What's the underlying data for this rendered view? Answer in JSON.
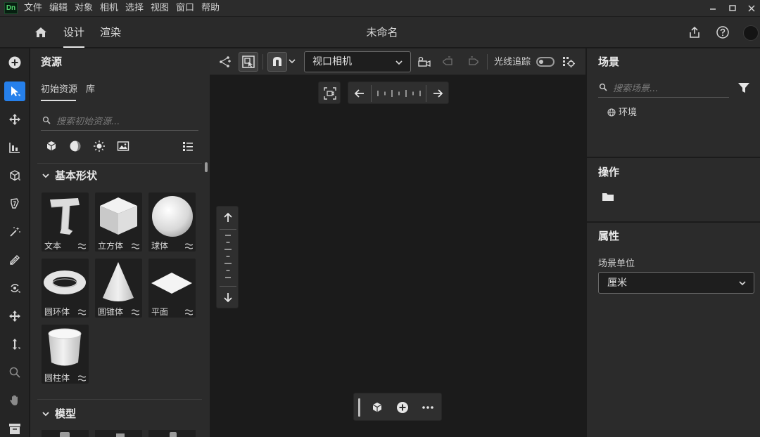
{
  "menubar": {
    "logo": "Dn",
    "items": [
      "文件",
      "编辑",
      "对象",
      "相机",
      "选择",
      "视图",
      "窗口",
      "帮助"
    ]
  },
  "header": {
    "tabs": [
      "设计",
      "渲染"
    ],
    "active_tab": "设计",
    "document_title": "未命名"
  },
  "assets": {
    "title": "资源",
    "subtabs": [
      "初始资源",
      "库"
    ],
    "active_subtab": "初始资源",
    "search_placeholder": "搜索初始资源...",
    "filter_icons": [
      "model-icon",
      "material-icon",
      "light-icon",
      "image-icon",
      "list-view-icon"
    ],
    "section_basic": "基本形状",
    "shapes": [
      "文本",
      "立方体",
      "球体",
      "圆环体",
      "圆锥体",
      "平面",
      "圆柱体"
    ],
    "section_models": "模型"
  },
  "viewport": {
    "camera_select": "视口相机",
    "raytrace_label": "光线追踪",
    "raytrace_enabled": false
  },
  "scene": {
    "title": "场景",
    "search_placeholder": "搜索场景...",
    "items": [
      "环境"
    ]
  },
  "actions": {
    "title": "操作"
  },
  "properties": {
    "title": "属性",
    "scene_unit_label": "场景单位",
    "scene_unit_value": "厘米"
  },
  "colors": {
    "accent": "#2680eb",
    "app_logo_green": "#52d26d",
    "panel_bg": "#2b2b2b",
    "viewport_bg": "#1b1b1b"
  }
}
